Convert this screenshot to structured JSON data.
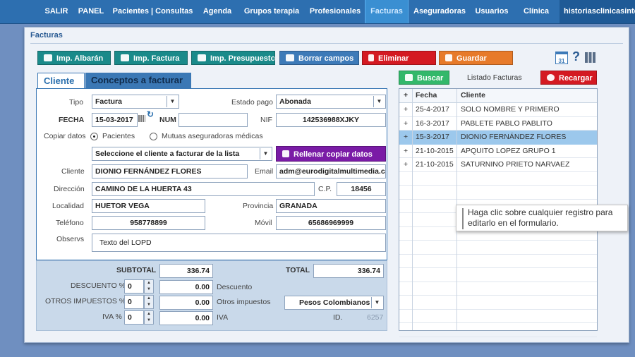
{
  "nav": {
    "items": [
      "SALIR",
      "PANEL",
      "Pacientes | Consultas",
      "Agenda",
      "Grupos terapia",
      "Profesionales",
      "Facturas",
      "Aseguradoras",
      "Usuarios",
      "Clínica"
    ],
    "active": "Facturas",
    "user": "historiasclinicasinte..."
  },
  "panel": {
    "title": "Facturas"
  },
  "toolbar": {
    "imp_albaran": "Imp. Albarán",
    "imp_factura": "Imp. Factura",
    "imp_presupuesto": "Imp. Presupuesto",
    "borrar": "Borrar campos",
    "eliminar": "Eliminar",
    "guardar": "Guardar",
    "calendar_day": "31",
    "help": "?"
  },
  "tabs": {
    "cliente": "Cliente",
    "conceptos": "Conceptos a facturar"
  },
  "form": {
    "tipo_label": "Tipo",
    "tipo_value": "Factura",
    "estado_label": "Estado pago",
    "estado_value": "Abonada",
    "fecha_label": "FECHA",
    "fecha_value": "15-03-2017",
    "num_label": "NUM",
    "num_value": "",
    "nif_label": "NIF",
    "nif_value": "142536988XJKY",
    "copiar_label": "Copiar datos",
    "radio_pacientes": "Pacientes",
    "radio_mutuas": "Mutuas aseguradoras médicas",
    "select_cliente": "Seleccione el cliente a facturar de la lista",
    "rellenar": "Rellenar copiar datos",
    "cliente_label": "Cliente",
    "cliente_value": "DIONIO FERNÁNDEZ FLORES",
    "email_label": "Email",
    "email_value": "adm@eurodigitalmultimedia.con",
    "direccion_label": "Dirección",
    "direccion_value": "CAMINO DE LA HUERTA 43",
    "cp_label": "C.P.",
    "cp_value": "18456",
    "localidad_label": "Localidad",
    "localidad_value": "HUETOR VEGA",
    "provincia_label": "Provincia",
    "provincia_value": "GRANADA",
    "telefono_label": "Teléfono",
    "telefono_value": "958778899",
    "movil_label": "Móvil",
    "movil_value": "65686969999",
    "observs_label": "Observs",
    "observs_value": "Texto del LOPD"
  },
  "totals": {
    "subtotal_label": "SUBTOTAL",
    "subtotal_value": "336.74",
    "total_label": "TOTAL",
    "total_value": "336.74",
    "descuento_label": "DESCUENTO %",
    "descuento_pct": "0",
    "descuento_value": "0.00",
    "descuento_text": "Descuento",
    "otros_label": "OTROS IMPUESTOS %",
    "otros_pct": "0",
    "otros_value": "0.00",
    "otros_text": "Otros impuestos",
    "iva_label": "IVA %",
    "iva_pct": "0",
    "iva_value": "0.00",
    "iva_text": "IVA",
    "moneda": "Pesos Colombianos",
    "id_label": "ID.",
    "id_value": "6257"
  },
  "list": {
    "buscar": "Buscar",
    "title": "Listado Facturas",
    "recargar": "Recargar",
    "headers": {
      "plus": "+",
      "fecha": "Fecha",
      "cliente": "Cliente"
    },
    "rows": [
      {
        "plus": "+",
        "fecha": "25-4-2017",
        "cliente": "SOLO NOMBRE Y PRIMERO"
      },
      {
        "plus": "+",
        "fecha": "16-3-2017",
        "cliente": "PABLETE PABLO PABLITO"
      },
      {
        "plus": "+",
        "fecha": "15-3-2017",
        "cliente": "DIONIO FERNÁNDEZ FLORES"
      },
      {
        "plus": "+",
        "fecha": "21-10-2015",
        "cliente": "APQUITO LOPEZ GRUPO 1"
      },
      {
        "plus": "+",
        "fecha": "21-10-2015",
        "cliente": "SATURNINO PRIETO NARVAEZ"
      }
    ],
    "selected_index": 2
  },
  "tooltip": {
    "text": "Haga clic sobre cualquier registro para editarlo en el formulario."
  },
  "colors": {
    "nav": "#2d6fb0",
    "teal_button": "#1a8a8a",
    "blue_button": "#3d7ab8",
    "red_button": "#d41a22",
    "orange_button": "#e77a2a",
    "green_button": "#33b86a",
    "purple_button": "#7a1ba6",
    "selected_row": "#9cc8ec"
  }
}
